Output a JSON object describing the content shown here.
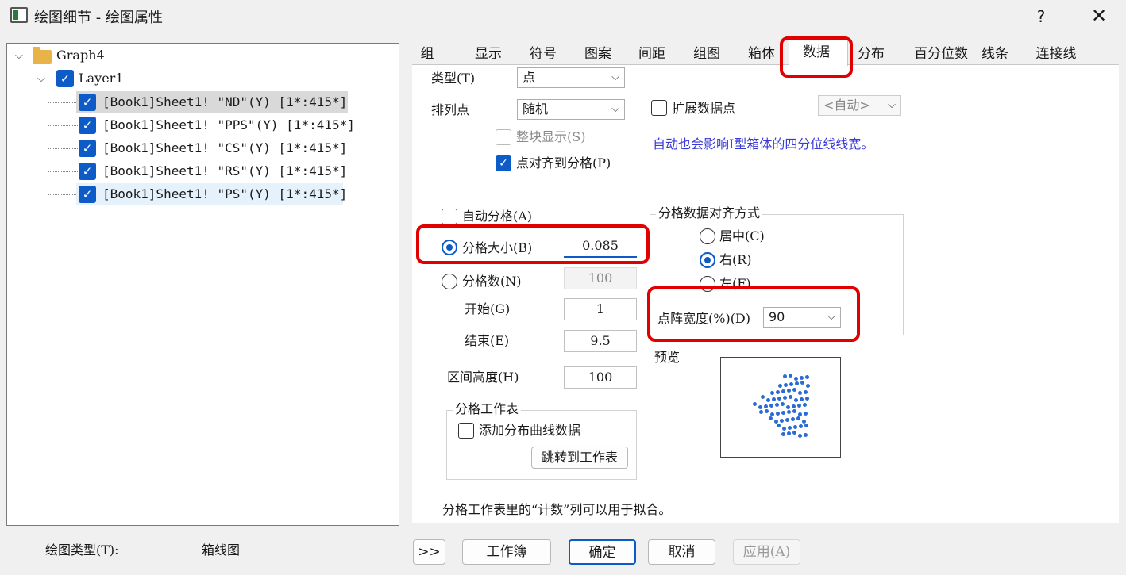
{
  "window": {
    "title": "绘图细节 - 绘图属性",
    "help_label": "?",
    "close_label": "✕"
  },
  "tree": {
    "root": "Graph4",
    "layer": "Layer1",
    "items": [
      "[Book1]Sheet1! \"ND\"(Y) [1*:415*]",
      "[Book1]Sheet1! \"PPS\"(Y) [1*:415*]",
      "[Book1]Sheet1! \"CS\"(Y) [1*:415*]",
      "[Book1]Sheet1! \"RS\"(Y) [1*:415*]",
      "[Book1]Sheet1! \"PS\"(Y) [1*:415*]"
    ]
  },
  "tabs": [
    "组",
    "显示",
    "符号",
    "图案",
    "间距",
    "组图",
    "箱体",
    "数据",
    "分布",
    "百分位数",
    "线条",
    "连接线"
  ],
  "active_tab": "数据",
  "data_tab": {
    "type_label": "类型(T)",
    "type_value": "点",
    "arrange_label": "排列点",
    "arrange_value": "随机",
    "expand_label": "扩展数据点",
    "expand_checked": false,
    "expand_value": "<自动>",
    "block_display_label": "整块显示(S)",
    "block_display_checked": false,
    "snap_label": "点对齐到分格(P)",
    "snap_checked": true,
    "note": "自动也会影响I型箱体的四分位线线宽。",
    "auto_bin_label": "自动分格(A)",
    "auto_bin_checked": false,
    "bin_size_label": "分格大小(B)",
    "bin_size_value": "0.085",
    "bin_count_label": "分格数(N)",
    "bin_count_value": "100",
    "start_label": "开始(G)",
    "start_value": "1",
    "end_label": "结束(E)",
    "end_value": "9.5",
    "interval_height_label": "区间高度(H)",
    "interval_height_value": "100",
    "align_group_label": "分格数据对齐方式",
    "align_center_label": "居中(C)",
    "align_right_label": "右(R)",
    "align_left_label": "左(F)",
    "align_selected": "右(R)",
    "dot_width_label": "点阵宽度(%)(D)",
    "dot_width_value": "90",
    "preview_label": "预览",
    "worksheet_group_label": "分格工作表",
    "add_curve_label": "添加分布曲线数据",
    "add_curve_checked": false,
    "goto_sheet_label": "跳转到工作表",
    "footer_note": "分格工作表里的“计数”列可以用于拟合。"
  },
  "bottom": {
    "plot_type_label": "绘图类型(T):",
    "plot_type_value": "箱线图",
    "expand_btn": ">>",
    "workbook_btn": "工作簿",
    "ok_btn": "确定",
    "cancel_btn": "取消",
    "apply_btn": "应用(A)"
  },
  "colors": {
    "accent": "#0d5bc6",
    "highlight": "#e00000",
    "note_text": "#3a3ad6",
    "preview_dots": "#2a6bd6"
  }
}
